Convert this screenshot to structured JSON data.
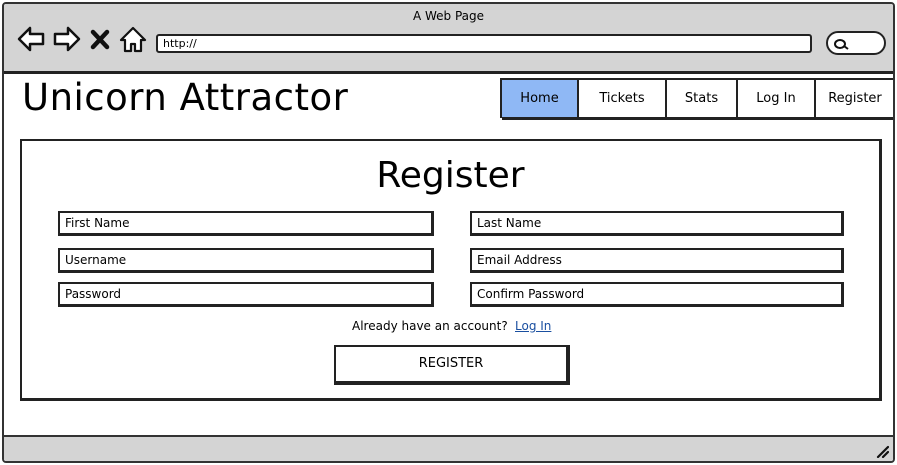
{
  "browser": {
    "window_title": "A Web Page",
    "address": "http://",
    "icons": [
      "back-icon",
      "forward-icon",
      "close-icon",
      "home-icon",
      "search-icon",
      "resize-grip-icon"
    ]
  },
  "site": {
    "brand": "Unicorn Attractor",
    "nav": [
      {
        "label": "Home",
        "active": true
      },
      {
        "label": "Tickets",
        "active": false
      },
      {
        "label": "Stats",
        "active": false
      },
      {
        "label": "Log In",
        "active": false
      },
      {
        "label": "Register",
        "active": false
      }
    ],
    "active_color": "#8fb8f5"
  },
  "form": {
    "title": "Register",
    "first_name": "First Name",
    "last_name": "Last Name",
    "username": "Username",
    "email": "Email Address",
    "password": "Password",
    "confirm_password": "Confirm Password",
    "already_text": "Already have an account?",
    "login_link": "Log In",
    "submit": "REGISTER"
  }
}
